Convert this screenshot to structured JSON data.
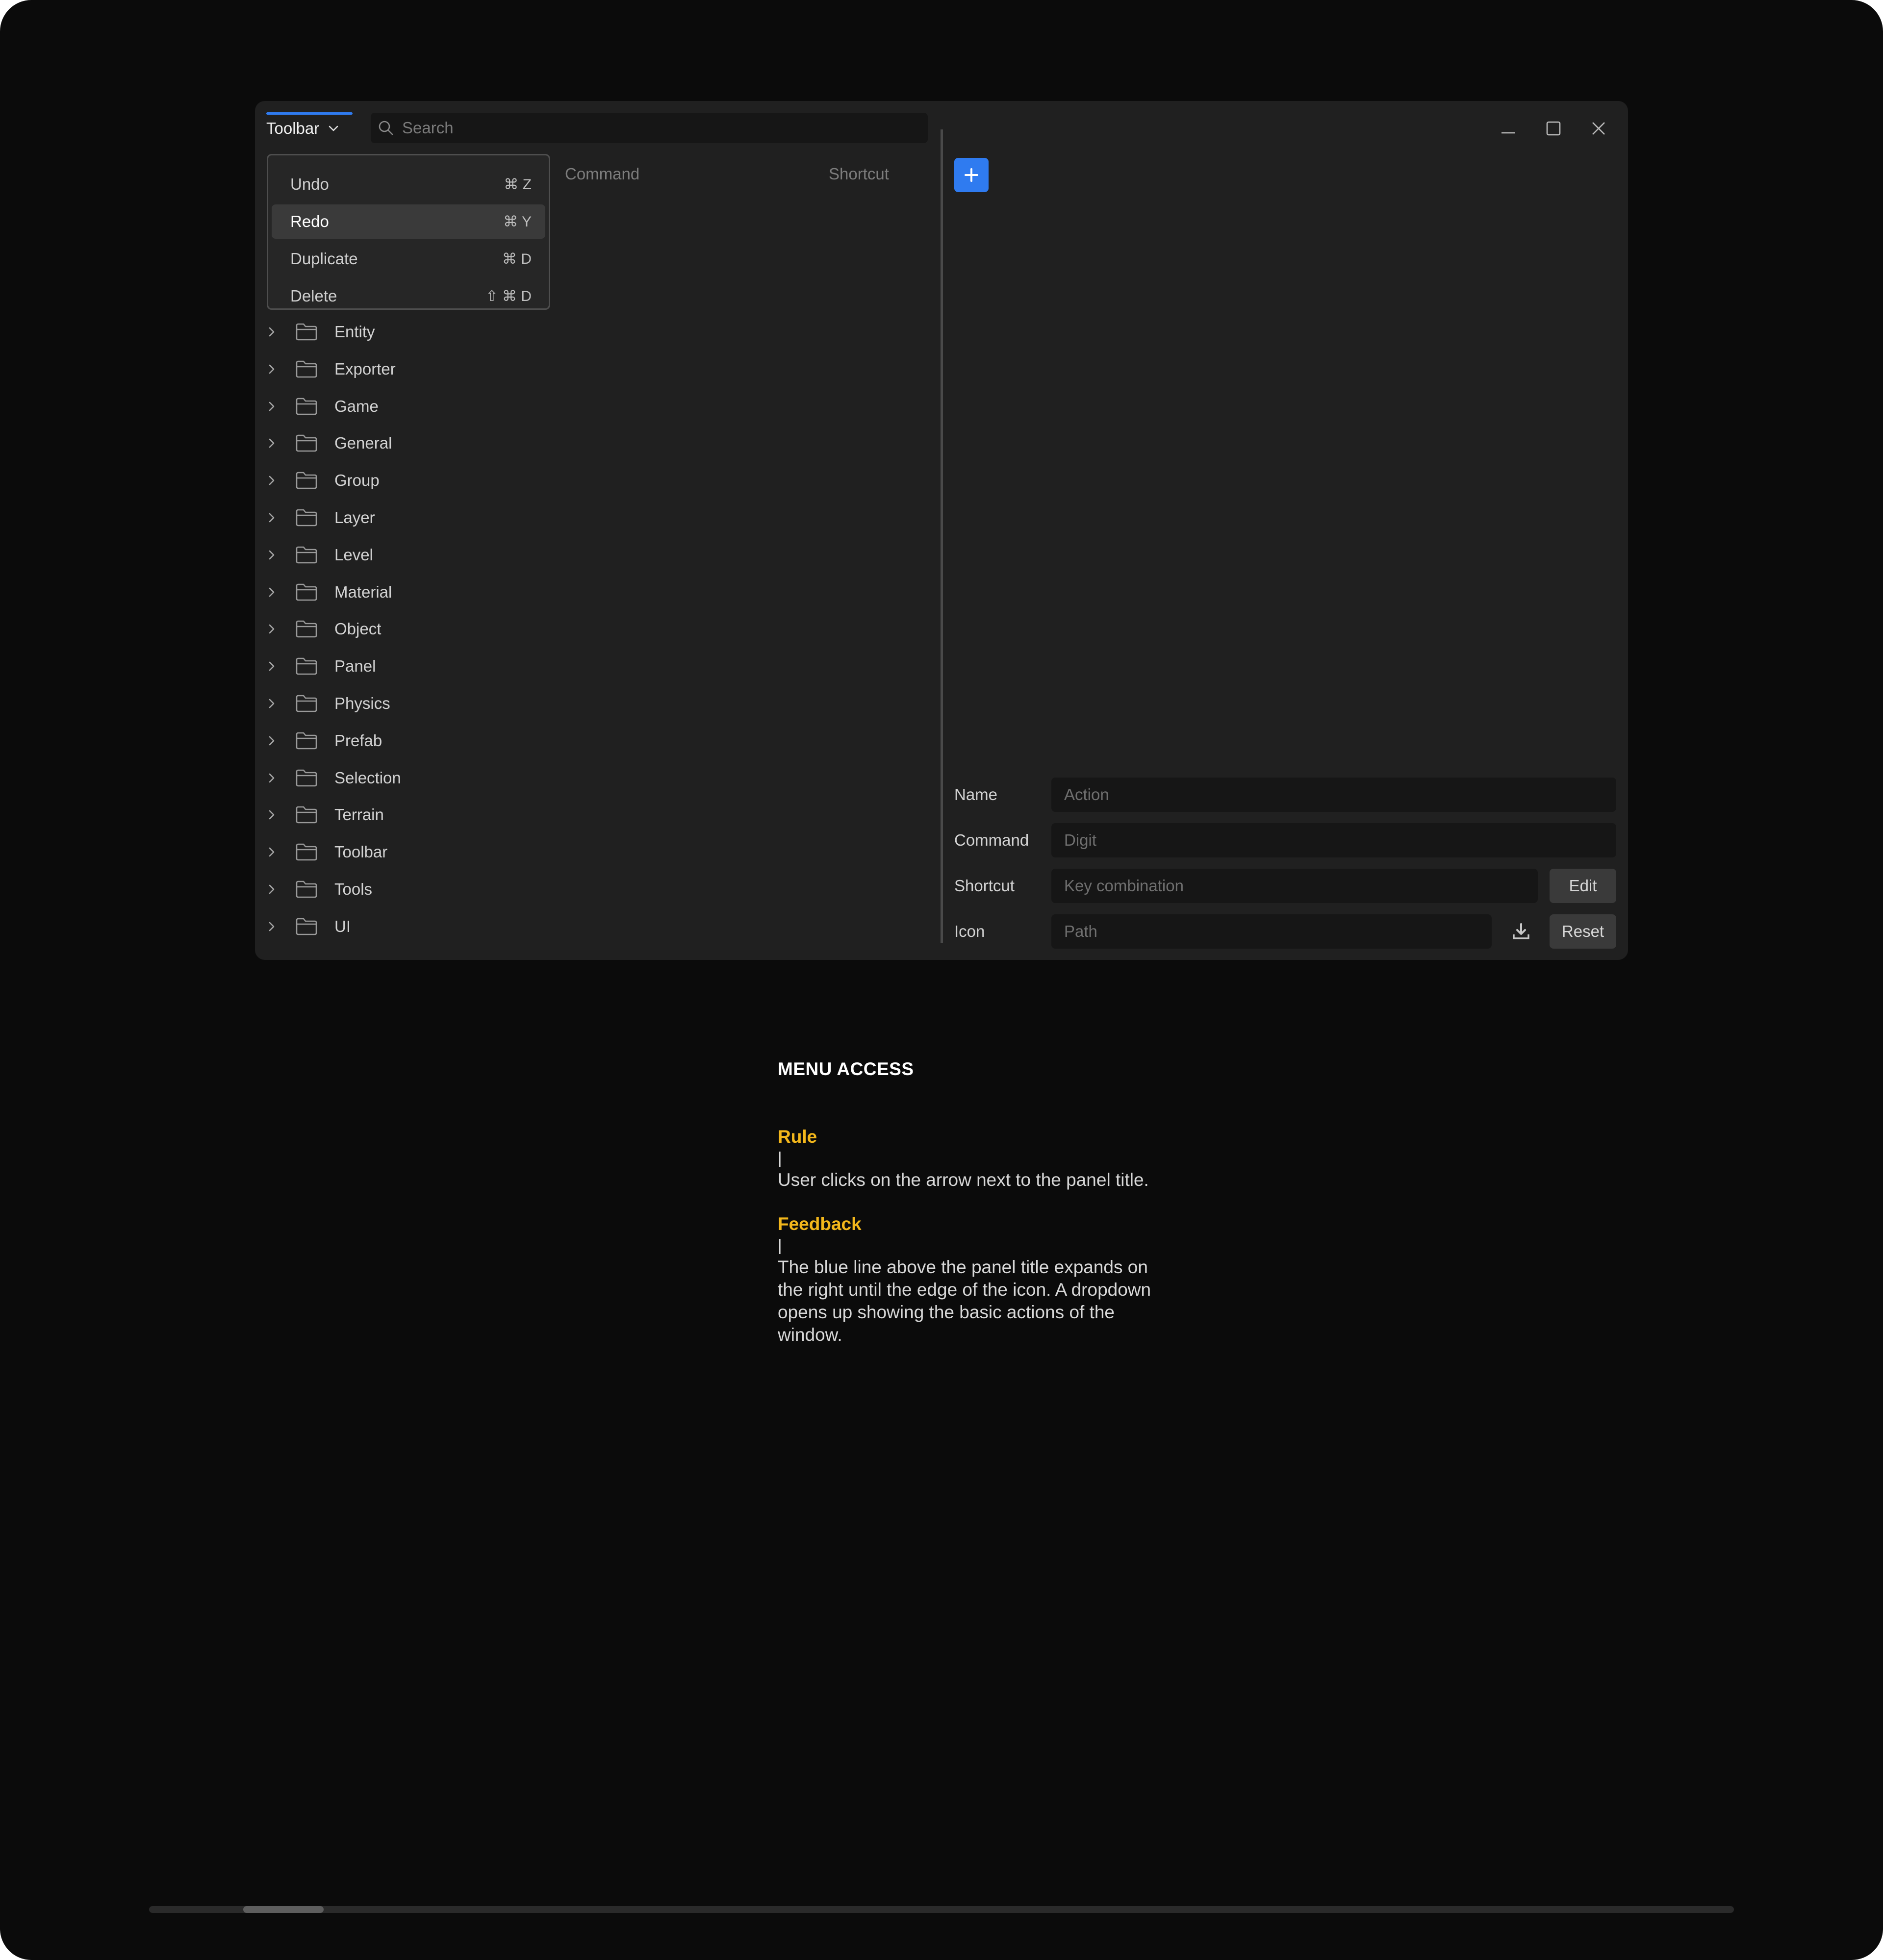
{
  "panel": {
    "title": "Toolbar",
    "search_placeholder": "Search",
    "accent_color": "#2f7bf0"
  },
  "columns": {
    "command": "Command",
    "shortcut": "Shortcut"
  },
  "dropdown": {
    "items": [
      {
        "label": "Undo",
        "shortcut": "⌘ Z",
        "active": false
      },
      {
        "label": "Redo",
        "shortcut": "⌘ Y",
        "active": true
      },
      {
        "label": "Duplicate",
        "shortcut": "⌘ D",
        "active": false
      },
      {
        "label": "Delete",
        "shortcut": "⇧ ⌘ D",
        "active": false
      }
    ]
  },
  "tree": {
    "items": [
      "Entity",
      "Exporter",
      "Game",
      "General",
      "Group",
      "Layer",
      "Level",
      "Material",
      "Object",
      "Panel",
      "Physics",
      "Prefab",
      "Selection",
      "Terrain",
      "Toolbar",
      "Tools",
      "UI"
    ]
  },
  "form": {
    "name_label": "Name",
    "name_placeholder": "Action",
    "command_label": "Command",
    "command_placeholder": "Digit",
    "shortcut_label": "Shortcut",
    "shortcut_placeholder": "Key combination",
    "edit_button": "Edit",
    "icon_label": "Icon",
    "icon_placeholder": "Path",
    "reset_button": "Reset"
  },
  "description": {
    "title": "MENU ACCESS",
    "rule_heading": "Rule",
    "rule_bar": "|",
    "rule_text": "User clicks on the arrow next to the panel title.",
    "feedback_heading": "Feedback",
    "feedback_bar": "|",
    "feedback_text": "The blue line above the panel title expands on the right until the edge of the icon. A dropdown opens up showing the basic actions of the window.",
    "heading_color": "#f3b71b"
  }
}
